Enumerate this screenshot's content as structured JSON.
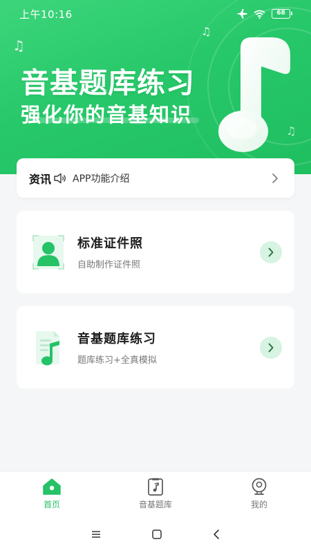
{
  "status_bar": {
    "time": "上午10:16",
    "battery": "68"
  },
  "hero": {
    "title": "音基题库练习",
    "subtitle": "强化你的音基知识"
  },
  "news": {
    "label": "资讯",
    "text": "APP功能介绍"
  },
  "cards": [
    {
      "title": "标准证件照",
      "desc": "自助制作证件照",
      "icon": "id-photo-icon"
    },
    {
      "title": "音基题库练习",
      "desc": "题库练习+全真模拟",
      "icon": "music-sheet-icon"
    }
  ],
  "tabbar": {
    "items": [
      {
        "label": "首页",
        "icon": "home-icon",
        "active": true
      },
      {
        "label": "音基题库",
        "icon": "music-book-icon",
        "active": false
      },
      {
        "label": "我的",
        "icon": "profile-icon",
        "active": false
      }
    ]
  },
  "colors": {
    "accent": "#25c266",
    "accent_light": "#d7f3e2",
    "background": "#f5f6f7"
  }
}
